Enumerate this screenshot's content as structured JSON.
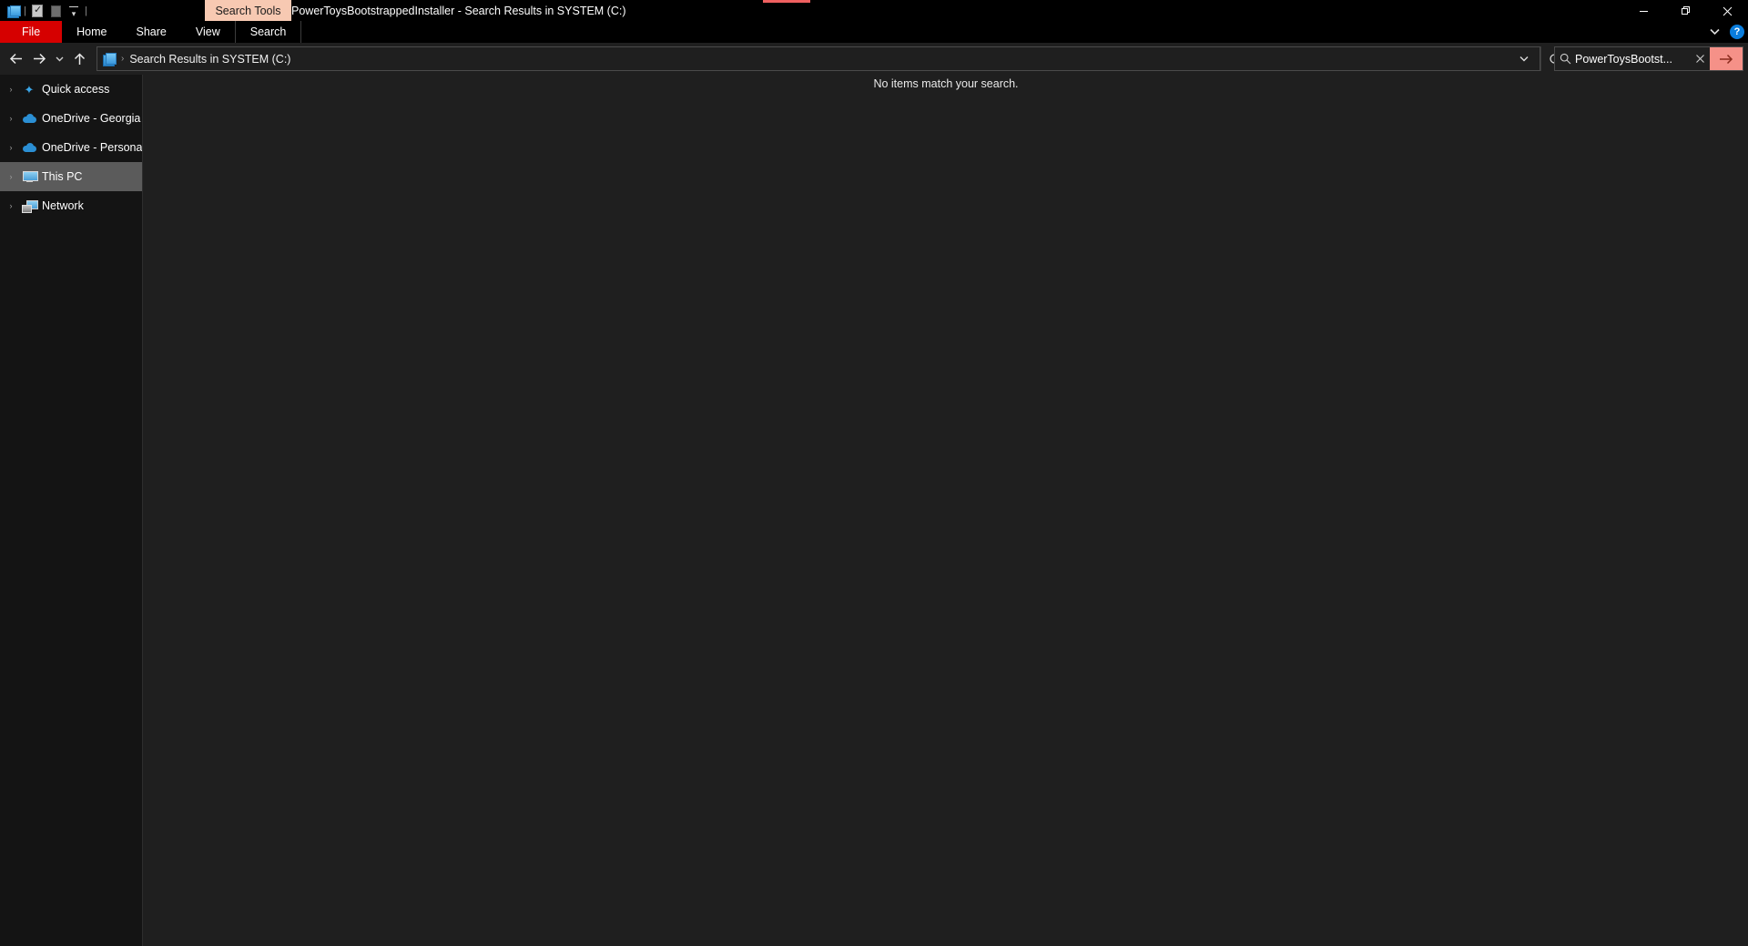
{
  "window": {
    "title": "PowerToysBootstrappedInstaller - Search Results in SYSTEM (C:)",
    "contextual_tab_header": "Search Tools",
    "accent_color": "#ef6060",
    "file_tab_color": "#d60000",
    "contextual_header_color": "#f7c9b2"
  },
  "quick_access_toolbar": {
    "items": [
      {
        "name": "library-icon",
        "label": "Properties"
      },
      {
        "name": "separator",
        "label": "|"
      },
      {
        "name": "properties-icon",
        "label": "Properties"
      },
      {
        "name": "new-folder-icon",
        "label": "New folder"
      },
      {
        "name": "customize-caret-icon",
        "label": "Customize Quick Access Toolbar"
      },
      {
        "name": "separator",
        "label": "|"
      }
    ]
  },
  "window_controls": {
    "minimize": "Minimize",
    "maximize": "Maximize",
    "close": "Close",
    "collapse_ribbon": "Minimize the Ribbon",
    "help": "?"
  },
  "ribbon": {
    "tabs": [
      {
        "id": "file",
        "label": "File"
      },
      {
        "id": "home",
        "label": "Home"
      },
      {
        "id": "share",
        "label": "Share"
      },
      {
        "id": "view",
        "label": "View"
      },
      {
        "id": "search",
        "label": "Search"
      }
    ],
    "active_tab": "File"
  },
  "address_bar": {
    "back": "◀",
    "forward": "▶",
    "recent": "⌄",
    "up": "↑",
    "breadcrumb": {
      "icon": "search-results-library-icon",
      "separator": "›",
      "text": "Search Results in SYSTEM (C:)"
    },
    "history_chevron": "⌄",
    "refresh": "↻"
  },
  "search": {
    "icon": "search-icon",
    "value": "PowerToysBootst...",
    "clear": "✕",
    "go": "→",
    "go_button_color": "#f59188"
  },
  "sidebar": {
    "items": [
      {
        "label": "Quick access",
        "icon": "star-icon",
        "expander": "›",
        "selected": false
      },
      {
        "label": "OneDrive - Georgia In",
        "icon": "cloud-icon",
        "expander": "›",
        "selected": false
      },
      {
        "label": "OneDrive - Personal",
        "icon": "cloud-icon",
        "expander": "›",
        "selected": false
      },
      {
        "label": "This PC",
        "icon": "computer-icon",
        "expander": "›",
        "selected": true
      },
      {
        "label": "Network",
        "icon": "network-icon",
        "expander": "›",
        "selected": false
      }
    ]
  },
  "content": {
    "empty_message": "No items match your search."
  }
}
